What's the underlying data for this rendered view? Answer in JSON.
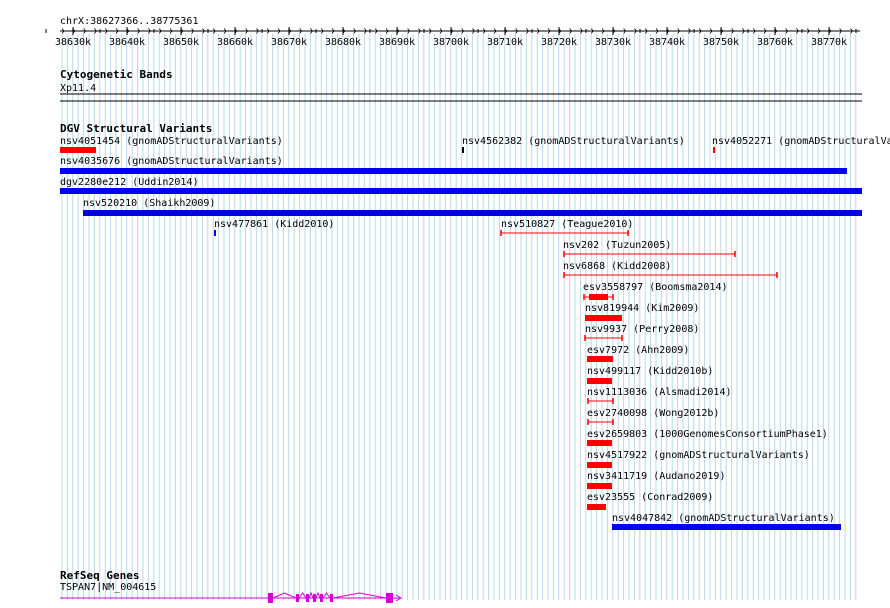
{
  "location_label": "chrX:38627366..38775361",
  "ruler": {
    "ticks": [
      "38630k",
      "38640k",
      "38650k",
      "38660k",
      "38670k",
      "38680k",
      "38690k",
      "38700k",
      "38710k",
      "38720k",
      "38730k",
      "38740k",
      "38750k",
      "38760k",
      "38770k"
    ]
  },
  "tracks": {
    "cytoband": {
      "title": "Cytogenetic Bands",
      "band": "Xp11.4"
    },
    "dgv": {
      "title": "DGV Structural Variants"
    },
    "refseq": {
      "title": "RefSeq Genes",
      "gene_label": "TSPAN7|NM_004615"
    }
  },
  "variants": [
    {
      "label": "nsv4051454 (gnomADStructuralVariants)",
      "color": "#ff0000",
      "style": "bar"
    },
    {
      "label": "nsv4562382 (gnomADStructuralVariants)",
      "color": "#000000",
      "style": "tick"
    },
    {
      "label": "nsv4052271 (gnomADStructuralVariants)",
      "color": "#ff0000",
      "style": "tick"
    },
    {
      "label": "nsv4035676 (gnomADStructuralVariants)",
      "color": "#0000ee",
      "style": "bar"
    },
    {
      "label": "dgv2280e212 (Uddin2014)",
      "color": "#0000ee",
      "style": "bar"
    },
    {
      "label": "nsv520210 (Shaikh2009)",
      "color": "#0000ee",
      "style": "bar"
    },
    {
      "label": "nsv477861 (Kidd2010)",
      "color": "#0000ee",
      "style": "tick"
    },
    {
      "label": "nsv510827 (Teague2010)",
      "color": "#ff0000",
      "style": "line"
    },
    {
      "label": "nsv202 (Tuzun2005)",
      "color": "#ff0000",
      "style": "line"
    },
    {
      "label": "nsv6868 (Kidd2008)",
      "color": "#ff0000",
      "style": "line"
    },
    {
      "label": "esv3558797 (Boomsma2014)",
      "color": "#ff0000",
      "style": "linebar"
    },
    {
      "label": "nsv819944 (Kim2009)",
      "color": "#ff0000",
      "style": "bar"
    },
    {
      "label": "nsv9937 (Perry2008)",
      "color": "#ff0000",
      "style": "line"
    },
    {
      "label": "esv7972 (Ahn2009)",
      "color": "#ff0000",
      "style": "bar"
    },
    {
      "label": "nsv499117 (Kidd2010b)",
      "color": "#ff0000",
      "style": "bar"
    },
    {
      "label": "nsv1113036 (Alsmadi2014)",
      "color": "#ff0000",
      "style": "line"
    },
    {
      "label": "esv2740098 (Wong2012b)",
      "color": "#ff0000",
      "style": "line"
    },
    {
      "label": "esv2659803 (1000GenomesConsortiumPhase1)",
      "color": "#ff0000",
      "style": "bar"
    },
    {
      "label": "nsv4517922 (gnomADStructuralVariants)",
      "color": "#ff0000",
      "style": "bar"
    },
    {
      "label": "nsv3411719 (Audano2019)",
      "color": "#ff0000",
      "style": "bar"
    },
    {
      "label": "esv23555 (Conrad2009)",
      "color": "#ff0000",
      "style": "bar"
    },
    {
      "label": "nsv4047842 (gnomADStructuralVariants)",
      "color": "#0000ee",
      "style": "bar"
    }
  ],
  "colors": {
    "grid": "#b8d8e6",
    "gene": "#d400d4",
    "gain": "#0000ee",
    "loss": "#ff0000"
  }
}
